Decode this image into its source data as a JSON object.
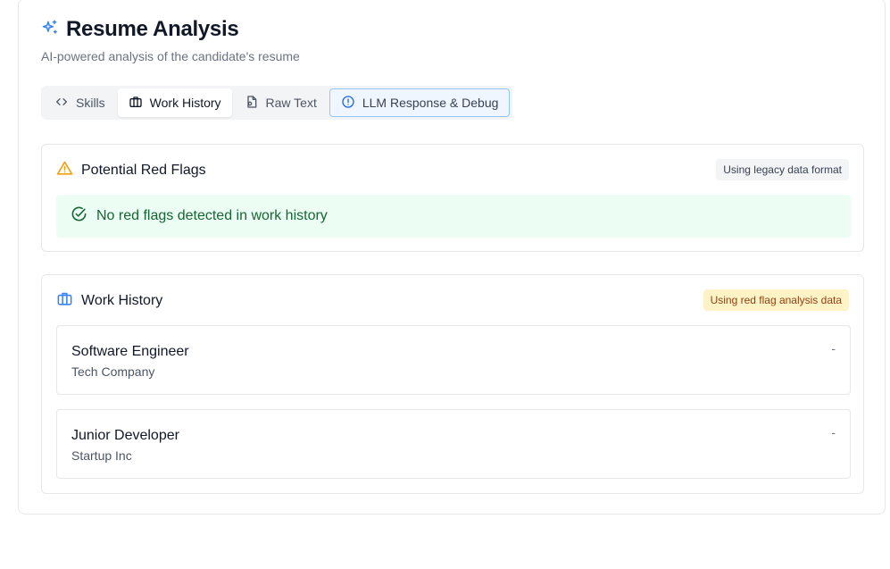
{
  "header": {
    "title": "Resume Analysis",
    "subtitle": "AI-powered analysis of the candidate's resume",
    "icon": "sparkles-icon"
  },
  "tabs": [
    {
      "label": "Skills",
      "icon": "code-icon",
      "state": "normal"
    },
    {
      "label": "Work History",
      "icon": "briefcase-icon",
      "state": "selected"
    },
    {
      "label": "Raw Text",
      "icon": "file-icon",
      "state": "normal"
    },
    {
      "label": "LLM Response & Debug",
      "icon": "alert-circle-icon",
      "state": "highlighted"
    }
  ],
  "red_flags": {
    "title": "Potential Red Flags",
    "badge": "Using legacy data format",
    "message": "No red flags detected in work history",
    "icon": "warning-icon",
    "message_icon": "check-circle-icon"
  },
  "work_history": {
    "title": "Work History",
    "badge": "Using red flag analysis data",
    "icon": "briefcase-icon",
    "jobs": [
      {
        "title": "Software Engineer",
        "company": "Tech Company",
        "dates": "-"
      },
      {
        "title": "Junior Developer",
        "company": "Startup Inc",
        "dates": "-"
      }
    ]
  },
  "colors": {
    "accent": "#3b82f6",
    "warning": "#f59e0b",
    "success_bg": "#ecfdf3",
    "success_text": "#166534",
    "badge_yellow_bg": "#fef3c7"
  }
}
